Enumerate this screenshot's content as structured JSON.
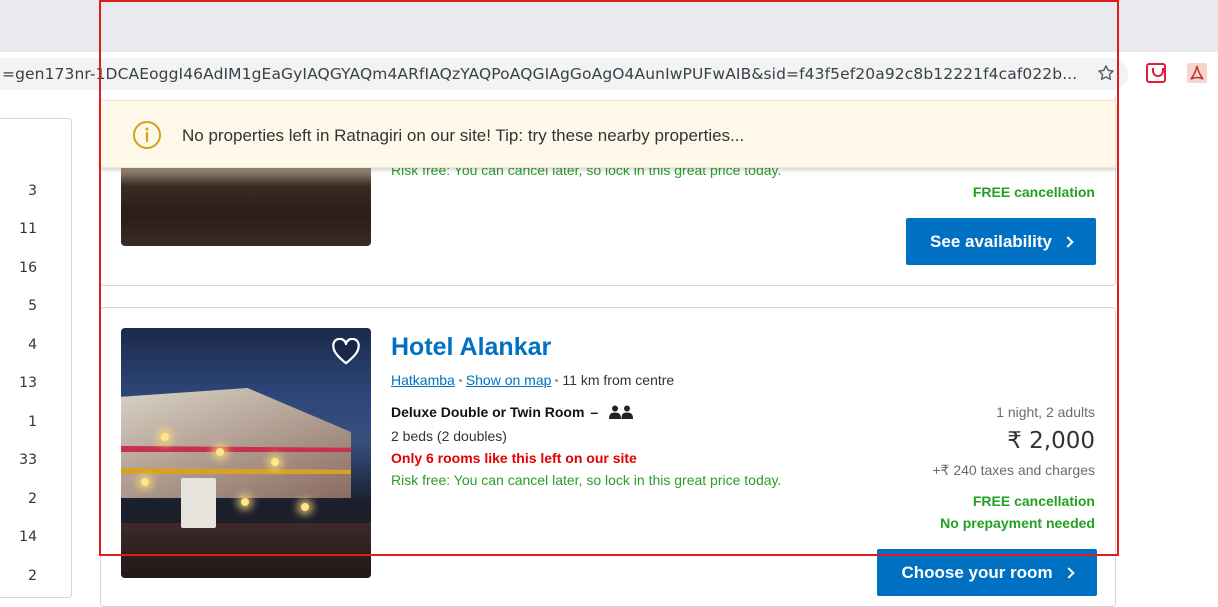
{
  "browser": {
    "url": "=gen173nr-1DCAEoggI46AdIM1gEaGyIAQGYAQm4ARfIAQzYAQPoAQGIAgGoAgO4AunIwPUFwAIB&sid=f43f5ef20a92c8b12221f4caf022b..."
  },
  "filter_counts": [
    "3",
    "11",
    "16",
    "5",
    "4",
    "13",
    "1",
    "33",
    "2",
    "14",
    "2"
  ],
  "notice": {
    "message": "No properties left in Ratnagiri on our site! Tip: try these nearby properties..."
  },
  "top_card": {
    "risk_free": "Risk free: You can cancel later, so lock in this great price today.",
    "free_cancellation": "FREE cancellation",
    "see_availability": "See availability"
  },
  "hotel": {
    "name": "Hotel Alankar",
    "area": "Hatkamba",
    "show_on_map": "Show on map",
    "distance": "11 km from centre",
    "room_type": "Deluxe Double or Twin Room",
    "room_dash": "–",
    "beds": "2 beds (2 doubles)",
    "availability": "Only 6 rooms like this left on our site",
    "risk_free": "Risk free: You can cancel later, so lock in this great price today.",
    "stay": "1 night, 2 adults",
    "price": "₹ 2,000",
    "taxes": "+₹ 240 taxes and charges",
    "free_cancellation": "FREE cancellation",
    "no_prepayment": "No prepayment needed",
    "choose_room": "Choose your room"
  },
  "colors": {
    "brand_blue": "#0071c2",
    "success_green": "#22a021",
    "urgency_red": "#e30000",
    "highlight_red": "#e01b1b"
  },
  "icons": [
    "star-icon",
    "pocket-icon",
    "pdf-icon",
    "info-icon",
    "heart-icon",
    "people-icon",
    "chevron-right-icon"
  ]
}
